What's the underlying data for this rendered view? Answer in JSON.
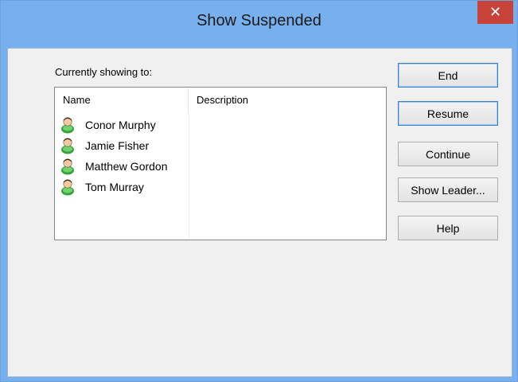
{
  "window": {
    "title": "Show Suspended",
    "close_glyph": "✕"
  },
  "group_label": "Currently showing to:",
  "list": {
    "columns": [
      "Name",
      "Description"
    ],
    "rows": [
      {
        "name": "Conor Murphy",
        "description": ""
      },
      {
        "name": "Jamie Fisher",
        "description": ""
      },
      {
        "name": "Matthew Gordon",
        "description": ""
      },
      {
        "name": "Tom Murray",
        "description": ""
      }
    ]
  },
  "buttons": {
    "end": "End",
    "resume": "Resume",
    "continue": "Continue",
    "show_leader": "Show Leader...",
    "help": "Help"
  },
  "colors": {
    "titlebar": "#78b0ee",
    "close": "#c8433a",
    "icon_green": "#3aa23a"
  }
}
